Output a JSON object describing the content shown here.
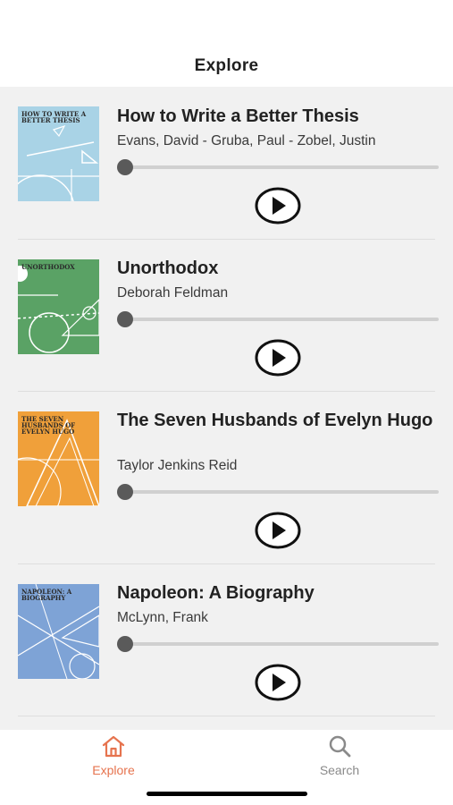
{
  "header": {
    "title": "Explore"
  },
  "books": [
    {
      "title": "How to Write a Better Thesis",
      "author": "Evans, David - Gruba, Paul - Zobel, Justin",
      "cover_text": "HOW TO WRITE A BETTER THESIS",
      "cover_color": "#a9d3e6",
      "progress": 0
    },
    {
      "title": "Unorthodox",
      "author": "Deborah Feldman",
      "cover_text": "UNORTHODOX",
      "cover_color": "#5aa265",
      "progress": 0
    },
    {
      "title": "The Seven Husbands of Evelyn Hugo",
      "author": "Taylor Jenkins Reid",
      "cover_text": "THE SEVEN HUSBANDS OF EVELYN HUGO",
      "cover_color": "#f0a03a",
      "progress": 0
    },
    {
      "title": "Napoleon: A Biography",
      "author": "McLynn, Frank",
      "cover_text": "NAPOLEON: A BIOGRAPHY",
      "cover_color": "#7ea3d6",
      "progress": 0
    }
  ],
  "tabbar": {
    "explore": {
      "label": "Explore",
      "icon": "home-icon",
      "color": "#e6734e"
    },
    "search": {
      "label": "Search",
      "icon": "search-icon",
      "color": "#8a8a8a"
    }
  }
}
